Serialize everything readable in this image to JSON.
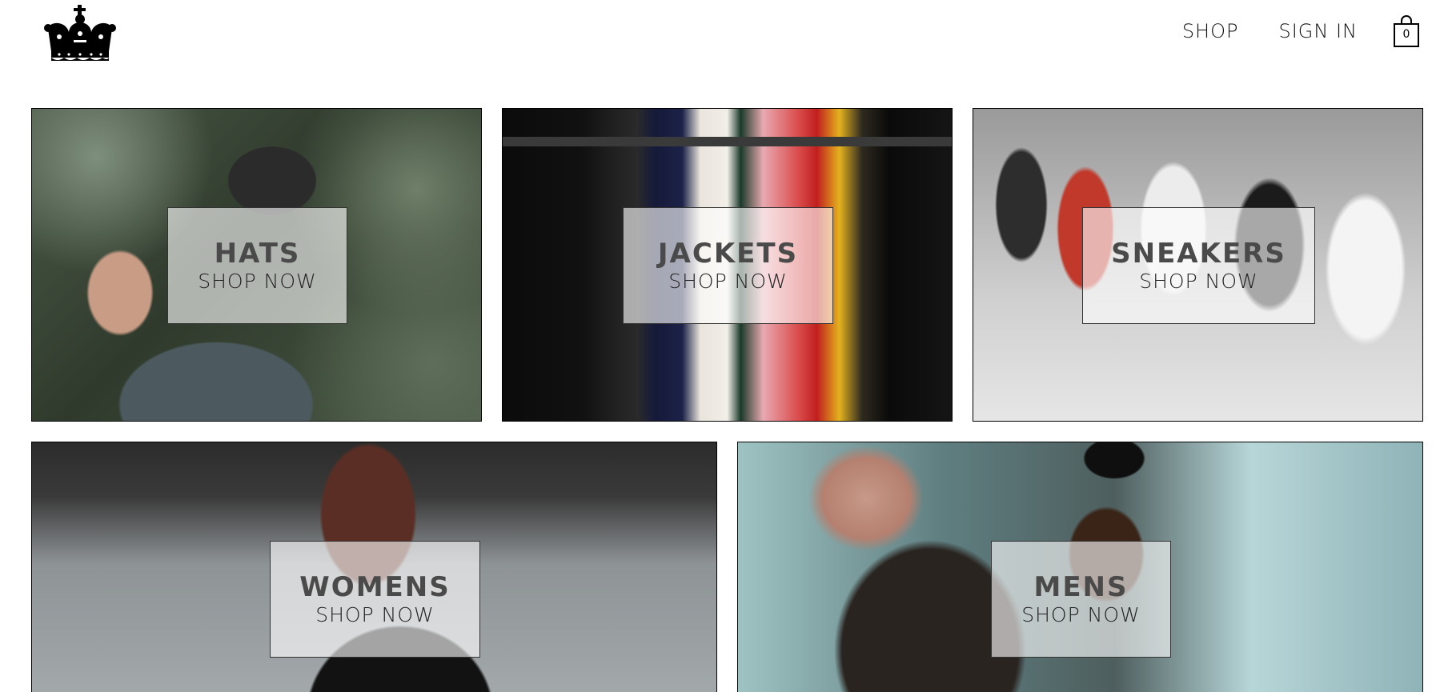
{
  "header": {
    "logo_icon": "crown-icon",
    "nav": {
      "shop_label": "SHOP",
      "signin_label": "SIGN IN"
    },
    "cart": {
      "icon": "shopping-bag-icon",
      "count": "0"
    }
  },
  "categories": [
    {
      "title": "HATS",
      "cta": "SHOP NOW"
    },
    {
      "title": "JACKETS",
      "cta": "SHOP NOW"
    },
    {
      "title": "SNEAKERS",
      "cta": "SHOP NOW"
    },
    {
      "title": "WOMENS",
      "cta": "SHOP NOW"
    },
    {
      "title": "MENS",
      "cta": "SHOP NOW"
    }
  ]
}
